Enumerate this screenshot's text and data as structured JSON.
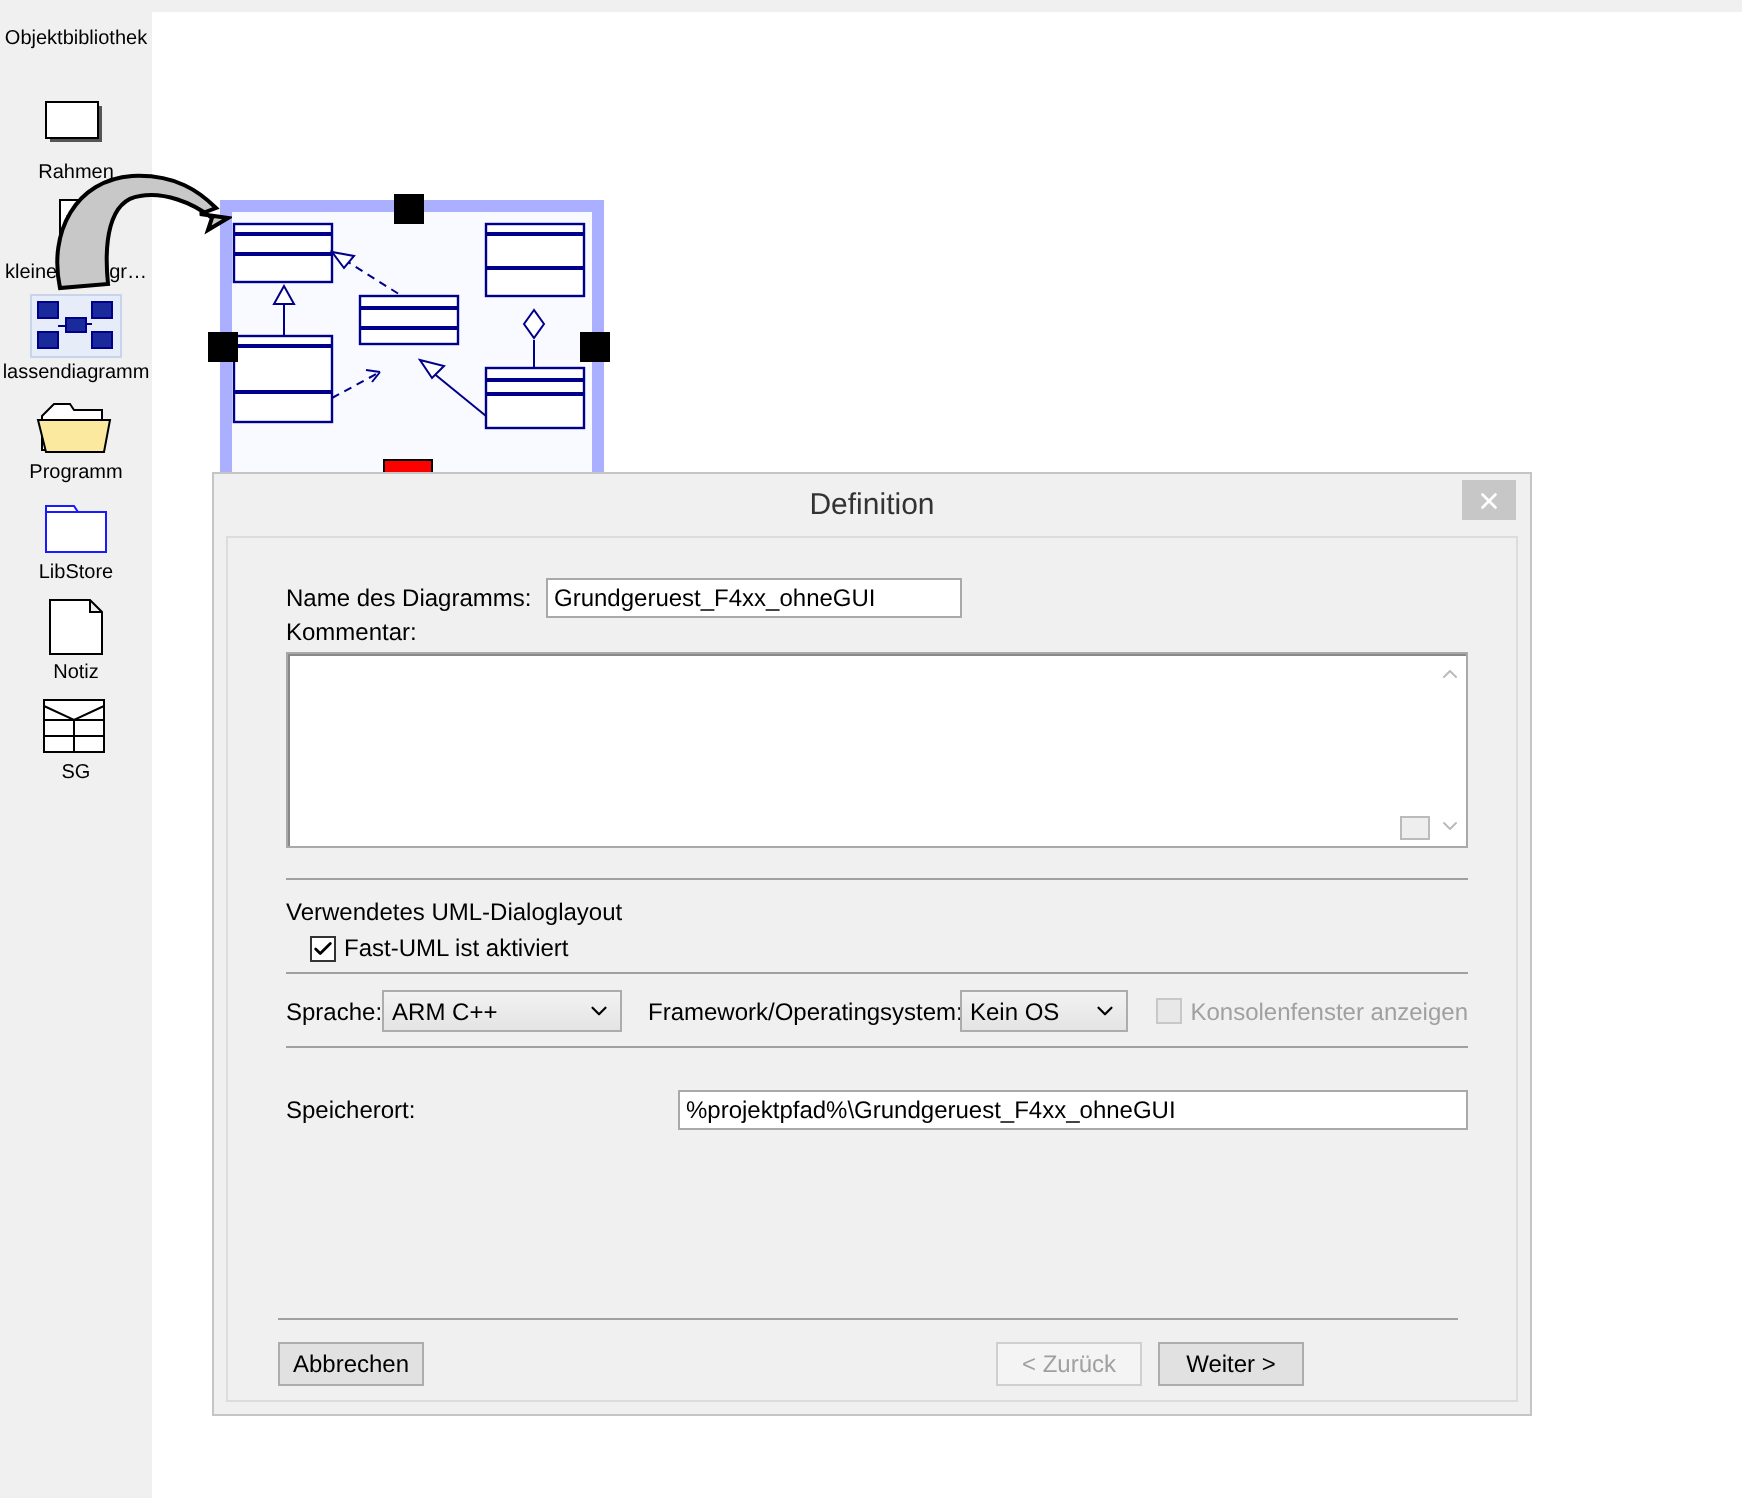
{
  "sidebar": {
    "title": "Objektbibliothek",
    "items": [
      {
        "label": "Rahmen",
        "kind": "frame",
        "selected": false
      },
      {
        "label": "kleine",
        "label_end": "gr…",
        "kind": "page",
        "selected": false
      },
      {
        "label": "lassendiagramm",
        "kind": "classdiagram",
        "selected": true
      },
      {
        "label": "Programm",
        "kind": "folder",
        "selected": false
      },
      {
        "label": "LibStore",
        "kind": "libstore",
        "selected": false
      },
      {
        "label": "Notiz",
        "kind": "note",
        "selected": false
      },
      {
        "label": "SG",
        "kind": "sg",
        "selected": false
      }
    ]
  },
  "dialog": {
    "title": "Definition",
    "name": {
      "label": "Name des Diagramms:",
      "value": "Grundgeruest_F4xx_ohneGUI"
    },
    "comment": {
      "label": "Kommentar:"
    },
    "layout": {
      "label": "Verwendetes UML-Dialoglayout",
      "option": {
        "label": "Fast-UML ist aktiviert",
        "checked": true
      }
    },
    "language": {
      "label": "Sprache:",
      "value": "ARM C++"
    },
    "framework": {
      "label": "Framework/Operatingsystem:",
      "value": "Kein OS"
    },
    "console": {
      "label": "Konsolenfenster anzeigen",
      "checked": false,
      "disabled": true
    },
    "location": {
      "label": "Speicherort:",
      "value": "%projektpfad%\\Grundgeruest_F4xx_ohneGUI"
    },
    "buttons": [
      {
        "label": "Abbrechen",
        "disabled": false
      },
      {
        "label": "< Zurück",
        "disabled": true
      },
      {
        "label": "Weiter >",
        "disabled": false
      }
    ]
  }
}
